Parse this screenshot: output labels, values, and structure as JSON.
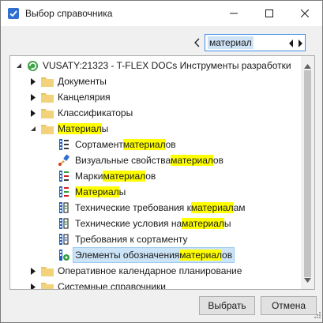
{
  "window": {
    "title": "Выбор справочника"
  },
  "search": {
    "value": "материал"
  },
  "tree": {
    "root": "VUSATY:21323 - T-FLEX DOCs Инструменты разработки",
    "nodes": [
      {
        "parts": [
          [
            "Документы",
            false
          ]
        ]
      },
      {
        "parts": [
          [
            "Канцелярия",
            false
          ]
        ]
      },
      {
        "parts": [
          [
            "Классификаторы",
            false
          ]
        ]
      },
      {
        "parts": [
          [
            "Материал",
            true
          ],
          [
            "ы",
            false
          ]
        ]
      },
      {
        "parts": [
          [
            "Сортамент ",
            false
          ],
          [
            "материал",
            true
          ],
          [
            "ов",
            false
          ]
        ]
      },
      {
        "parts": [
          [
            "Визуальные свойства ",
            false
          ],
          [
            "материал",
            true
          ],
          [
            "ов",
            false
          ]
        ]
      },
      {
        "parts": [
          [
            "Марки ",
            false
          ],
          [
            "материал",
            true
          ],
          [
            "ов",
            false
          ]
        ]
      },
      {
        "parts": [
          [
            "Материал",
            true
          ],
          [
            "ы",
            false
          ]
        ]
      },
      {
        "parts": [
          [
            "Технические требования к ",
            false
          ],
          [
            "материал",
            true
          ],
          [
            "ам",
            false
          ]
        ]
      },
      {
        "parts": [
          [
            "Технические условия на ",
            false
          ],
          [
            "материал",
            true
          ],
          [
            "ы",
            false
          ]
        ]
      },
      {
        "parts": [
          [
            "Требования к сортаменту",
            false
          ]
        ]
      },
      {
        "parts": [
          [
            "Элементы обозначения ",
            false
          ],
          [
            "материал",
            true
          ],
          [
            "ов",
            false
          ]
        ]
      },
      {
        "parts": [
          [
            "Оперативное календарное планирование",
            false
          ]
        ]
      },
      {
        "parts": [
          [
            "Системные справочники",
            false
          ]
        ]
      }
    ]
  },
  "buttons": {
    "select": "Выбрать",
    "cancel": "Отмена"
  },
  "colors": {
    "highlight": "#ffff00",
    "selection": "#cce4f7",
    "folder": "#e8c463",
    "focus_border": "#3d8ee6"
  }
}
